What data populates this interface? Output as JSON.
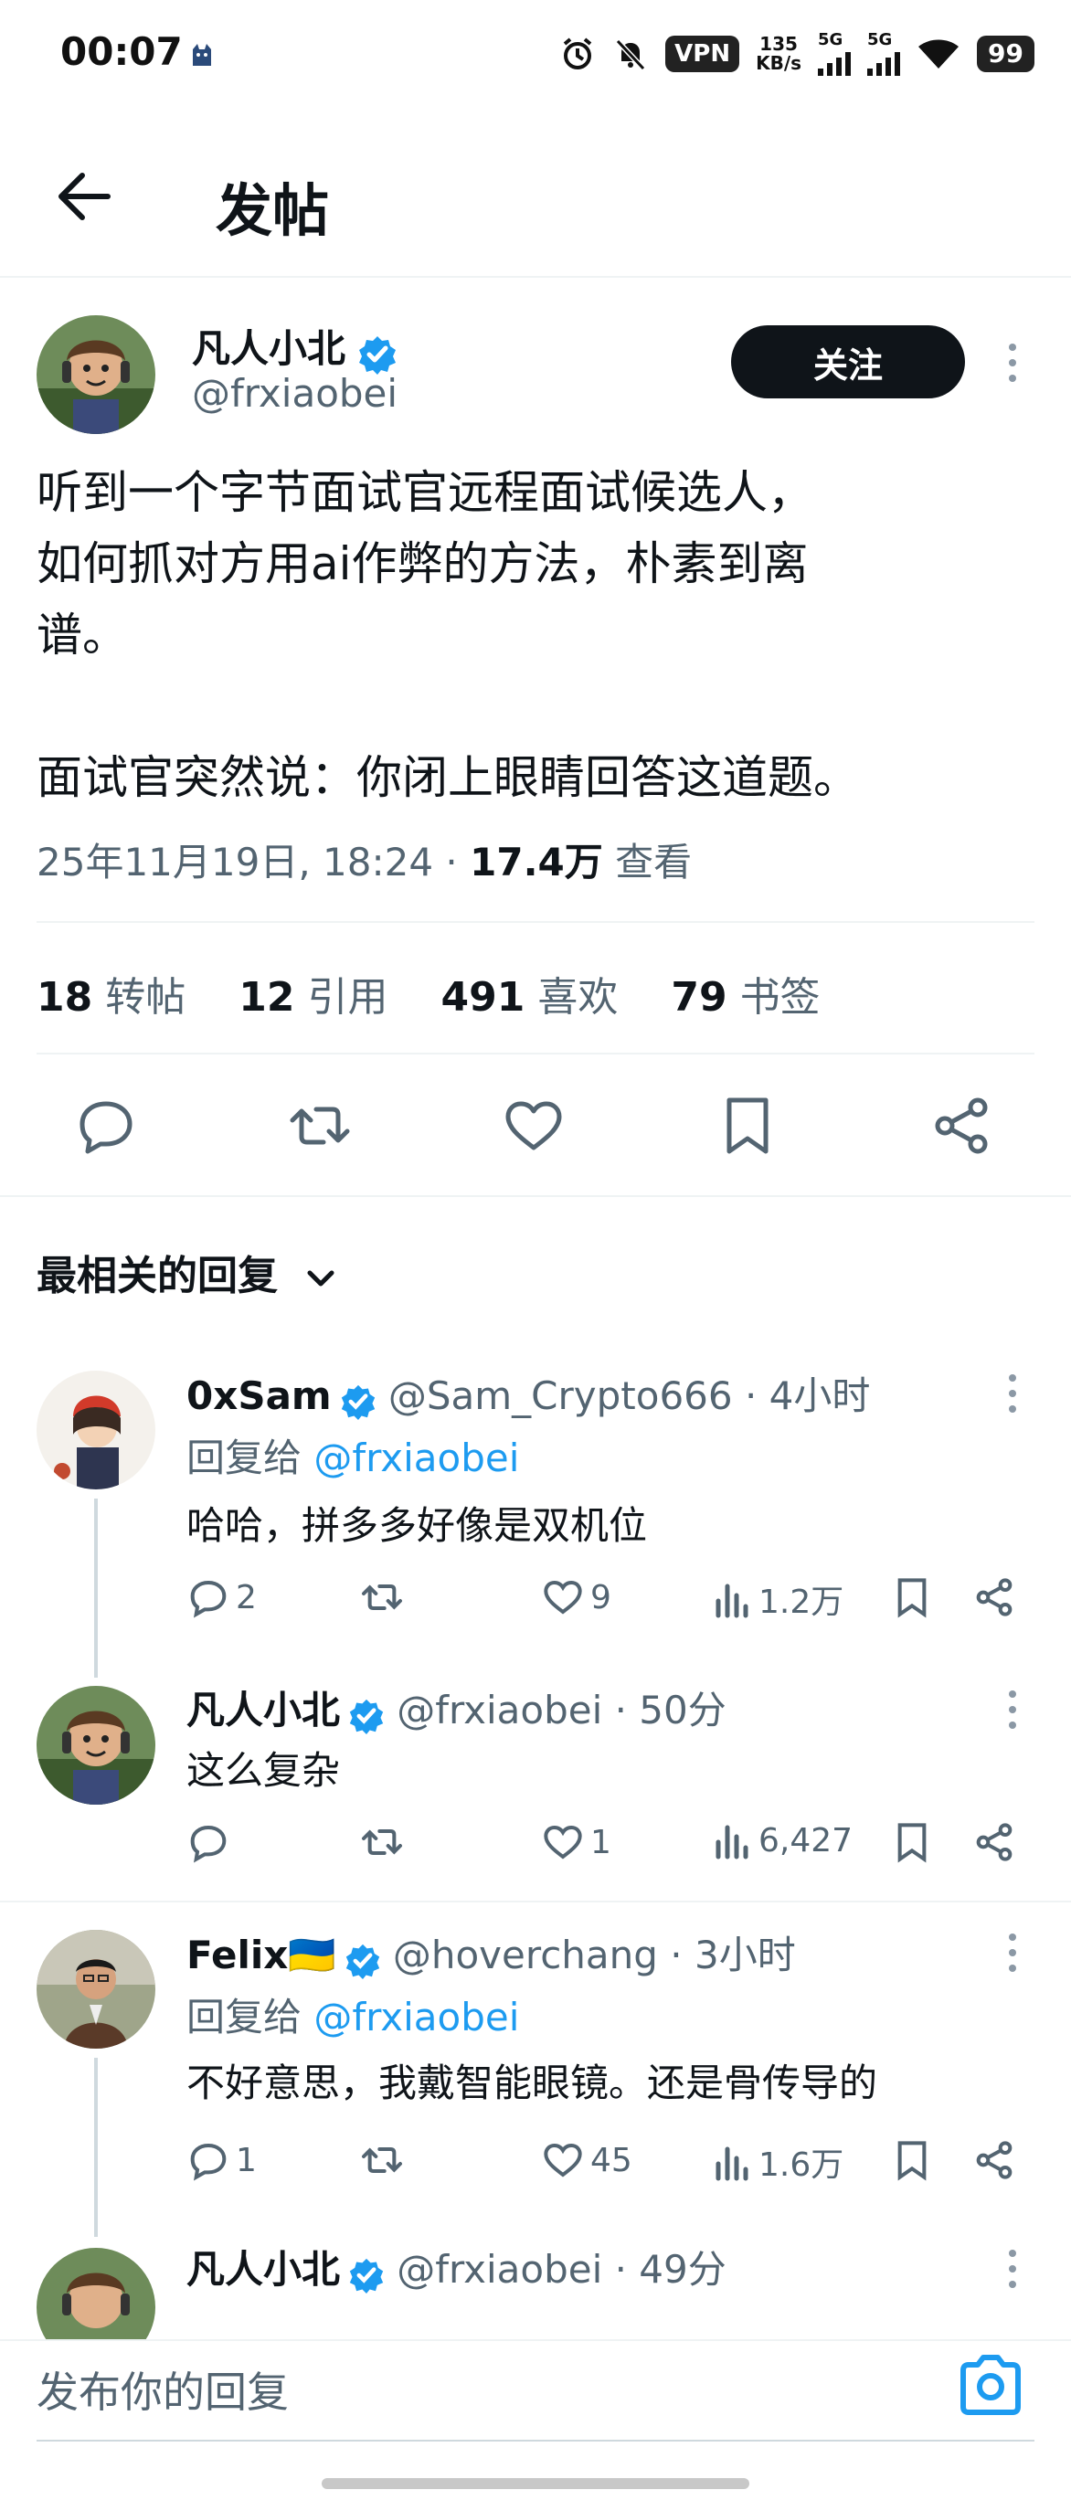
{
  "status_bar": {
    "time": "00:07",
    "vpn": "VPN",
    "speed_value": "135",
    "speed_unit": "KB/s",
    "net1": "5G",
    "net2": "5G",
    "battery": "99"
  },
  "header": {
    "title": "发帖"
  },
  "post": {
    "author_name": "凡人小北",
    "author_handle": "@frxiaobei",
    "follow_label": "关注",
    "text": "听到一个字节面试官远程面试候选人，\n如何抓对方用ai作弊的方法，朴素到离\n谱。\n\n面试官突然说：你闭上眼睛回答这道题。",
    "timestamp": "25年11月19日, 18:24 · ",
    "views_count": "17.4万",
    "views_label": " 查看",
    "stats": {
      "retweets": "18",
      "retweets_label": "转帖",
      "quotes": "12",
      "quotes_label": "引用",
      "likes": "491",
      "likes_label": "喜欢",
      "bookmarks": "79",
      "bookmarks_label": "书签"
    }
  },
  "replies_section": {
    "title": "最相关的回复"
  },
  "replies": [
    {
      "name": "0xSam",
      "handle": "@Sam_Crypto666 · 4小时",
      "reply_to_prefix": "回复给 ",
      "reply_to": "@frxiaobei",
      "text": "哈哈，拼多多好像是双机位",
      "reply_count": "2",
      "retweet_count": "",
      "like_count": "9",
      "views": "1.2万"
    },
    {
      "name": "凡人小北",
      "handle": "@frxiaobei · 50分",
      "text": "这么复杂",
      "reply_count": "",
      "retweet_count": "",
      "like_count": "1",
      "views": "6,427"
    },
    {
      "name": "Felix🇺🇦",
      "handle": "@hoverchang · 3小时",
      "reply_to_prefix": "回复给 ",
      "reply_to": "@frxiaobei",
      "text": "不好意思，我戴智能眼镜。还是骨传导的",
      "reply_count": "1",
      "retweet_count": "",
      "like_count": "45",
      "views": "1.6万"
    },
    {
      "name": "凡人小北",
      "handle": "@frxiaobei · 49分"
    }
  ],
  "compose": {
    "placeholder": "发布你的回复"
  },
  "colors": {
    "accent": "#1d9bf0",
    "text": "#0f1419",
    "muted": "#536471",
    "button": "#0f1419"
  }
}
